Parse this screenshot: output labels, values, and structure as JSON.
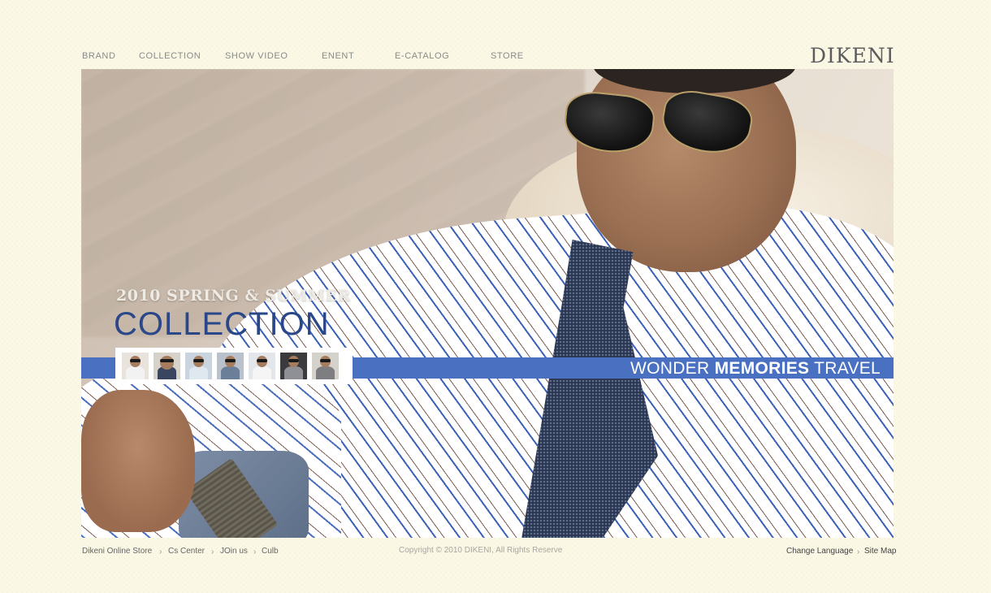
{
  "nav": {
    "items": [
      {
        "label": "BRAND"
      },
      {
        "label": "COLLECTION"
      },
      {
        "label": "SHOW VIDEO"
      },
      {
        "label": "ENENT"
      },
      {
        "label": "E-CATALOG"
      },
      {
        "label": "STORE"
      }
    ]
  },
  "brand": {
    "logo": "DIKENI"
  },
  "hero": {
    "season": "2010 SPRING & SUMMER",
    "title": "COLLECTION",
    "tagline_pre": "WONDER ",
    "tagline_bold": "MEMORIES",
    "tagline_post": " TRAVEL",
    "band_color": "#4a70c2",
    "title_color": "#2a4789"
  },
  "thumbnails": [
    {
      "name": "look-1"
    },
    {
      "name": "look-2"
    },
    {
      "name": "look-3"
    },
    {
      "name": "look-4"
    },
    {
      "name": "look-5"
    },
    {
      "name": "look-6"
    },
    {
      "name": "look-7"
    }
  ],
  "footer": {
    "links": [
      {
        "label": "Dikeni Online Store"
      },
      {
        "label": "Cs Center"
      },
      {
        "label": "JOin us"
      },
      {
        "label": "Culb"
      }
    ],
    "separator": "›",
    "copyright": "Copyright © 2010 DIKENI, All Rights Reserve",
    "right_links": [
      {
        "label": "Change Language"
      },
      {
        "label": "Site Map"
      }
    ]
  }
}
